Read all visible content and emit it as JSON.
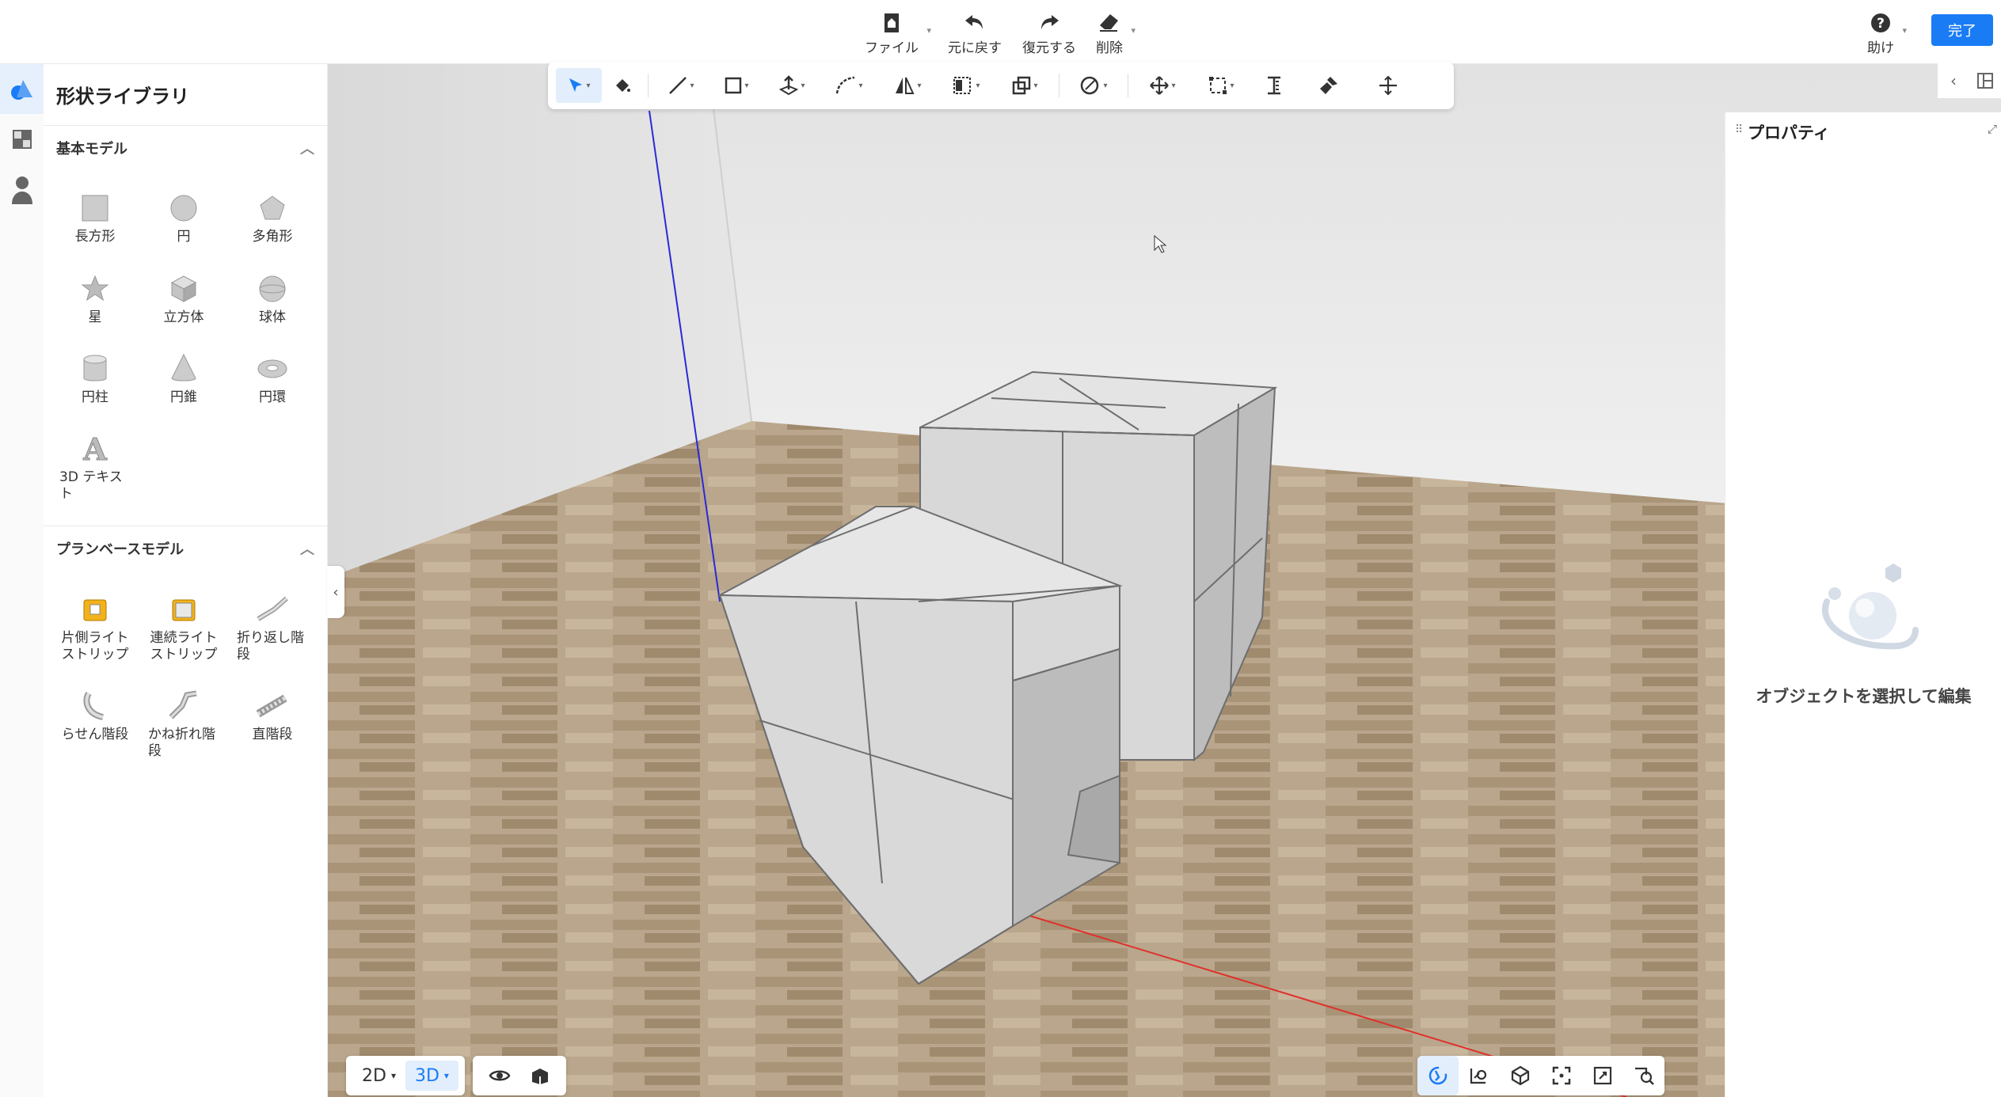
{
  "topbar": {
    "file": "ファイル",
    "undo": "元に戻す",
    "redo": "復元する",
    "delete": "削除",
    "help": "助け",
    "done": "完了"
  },
  "library": {
    "title": "形状ライブラリ",
    "basic_section": "基本モデル",
    "basic_items": [
      "長方形",
      "円",
      "多角形",
      "星",
      "立方体",
      "球体",
      "円柱",
      "円錐",
      "円環",
      "3D テキスト"
    ],
    "plan_section": "プランベースモデル",
    "plan_items": [
      "片側ライトストリップ",
      "連続ライトストリップ",
      "折り返し階段",
      "らせん階段",
      "かね折れ階段",
      "直階段"
    ]
  },
  "properties": {
    "title": "プロパティ",
    "empty_message": "オブジェクトを選択して編集"
  },
  "view": {
    "mode_2d": "2D",
    "mode_3d": "3D",
    "active_mode": "3D"
  },
  "icons": {
    "rail": [
      "shape-library-icon",
      "material-icon",
      "person-icon"
    ],
    "toolbar": [
      "select-arrow-icon",
      "paint-bucket-icon",
      "line-icon",
      "rectangle-icon",
      "push-pull-icon",
      "arc-icon",
      "mirror-icon",
      "align-icon",
      "combine-icon",
      "material-brush-icon",
      "move-icon",
      "scale-icon",
      "measure-icon",
      "paint-icon",
      "tape-icon"
    ]
  },
  "colors": {
    "accent": "#1a7cf5",
    "floor": "#b29e84",
    "wall": "#e9e9e9",
    "cube": "#d6d6d6",
    "axis_x": "#e0302a",
    "axis_z": "#2a2ad6"
  }
}
